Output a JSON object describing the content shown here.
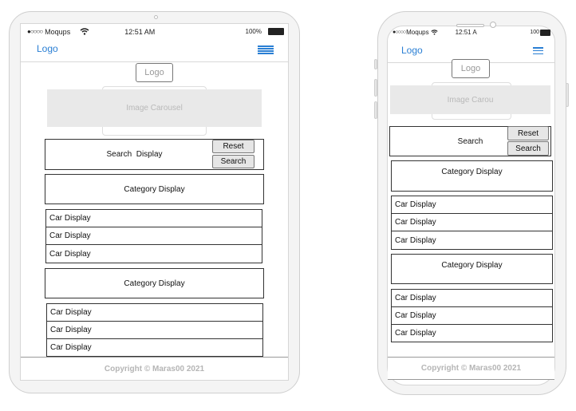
{
  "tablet": {
    "status": {
      "signal": "●○○○○",
      "carrier": "Moqups",
      "time": "12:51 AM",
      "battery": "100%"
    },
    "logo_link": "Logo",
    "logo_box": "Logo",
    "carousel": "Image Carousel",
    "search_display": "Search  Display",
    "reset_button": "Reset",
    "search_button": "Search",
    "groups": [
      {
        "category": "Category Display",
        "cars": [
          "Car Display",
          "Car Display",
          "Car Display"
        ]
      },
      {
        "category": "Category Display",
        "cars": [
          "Car Display",
          "Car Display",
          "Car Display"
        ]
      }
    ],
    "footer": "Copyright © Maras00 2021"
  },
  "phone": {
    "status": {
      "signal": "●○○○○",
      "carrier": "Moqups",
      "time": "12:51 A",
      "battery": "100"
    },
    "logo_link": "Logo",
    "logo_box": "Logo",
    "carousel": "Image Carou",
    "search_display": "Search",
    "reset_button": "Reset",
    "search_button": "Search",
    "groups": [
      {
        "category": "Category Display",
        "cars": [
          "Car Display",
          "Car Display",
          "Car Display"
        ]
      },
      {
        "category": "Category Display",
        "cars": [
          "Car Display",
          "Car Display",
          "Car Display"
        ]
      }
    ],
    "footer": "Copyright © Maras00 2021"
  },
  "colors": {
    "accent": "#2a7fd4",
    "frame": "#cfcfcf",
    "placeholder": "#e9e9e9",
    "footer_text": "#b5b5b5"
  },
  "icons": [
    "wifi-icon",
    "battery-icon",
    "hamburger-menu-icon",
    "camera-icon",
    "speaker-icon"
  ]
}
